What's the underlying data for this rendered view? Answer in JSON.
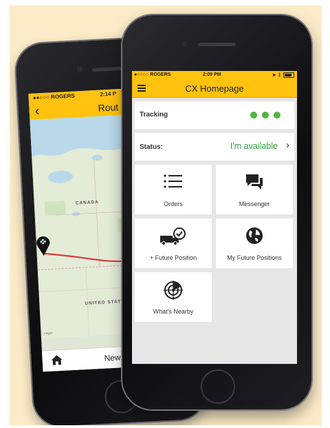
{
  "back_phone": {
    "status": {
      "carrier": "●●○○○ ROGERS",
      "time": "2:14 P"
    },
    "nav": {
      "title": "Rout"
    },
    "map": {
      "country_label_1": "CANADA",
      "country_label_2": "UNITED STATES",
      "legal_label": "Legal"
    },
    "tabbar": {
      "new_action": "New Ac"
    }
  },
  "front_phone": {
    "status": {
      "carrier": "●○○○○ ROGERS",
      "time": "2:09 PM"
    },
    "nav": {
      "title": "CX Homepage"
    },
    "tracking": {
      "label": "Tracking",
      "indicator_color": "#4cb83a"
    },
    "availability": {
      "label": "Status:",
      "value": "I'm available",
      "value_color": "#2fa23f"
    },
    "tiles": [
      {
        "label": "Orders",
        "icon": "list-icon"
      },
      {
        "label": "Messenger",
        "icon": "chat-icon"
      },
      {
        "label": "+ Future Position",
        "icon": "truck-check-icon"
      },
      {
        "label": "My Future Positions",
        "icon": "globe-icon"
      },
      {
        "label": "What's Nearby",
        "icon": "radar-icon"
      }
    ]
  },
  "colors": {
    "accent": "#ffc20e",
    "background": "#fbebc8"
  }
}
